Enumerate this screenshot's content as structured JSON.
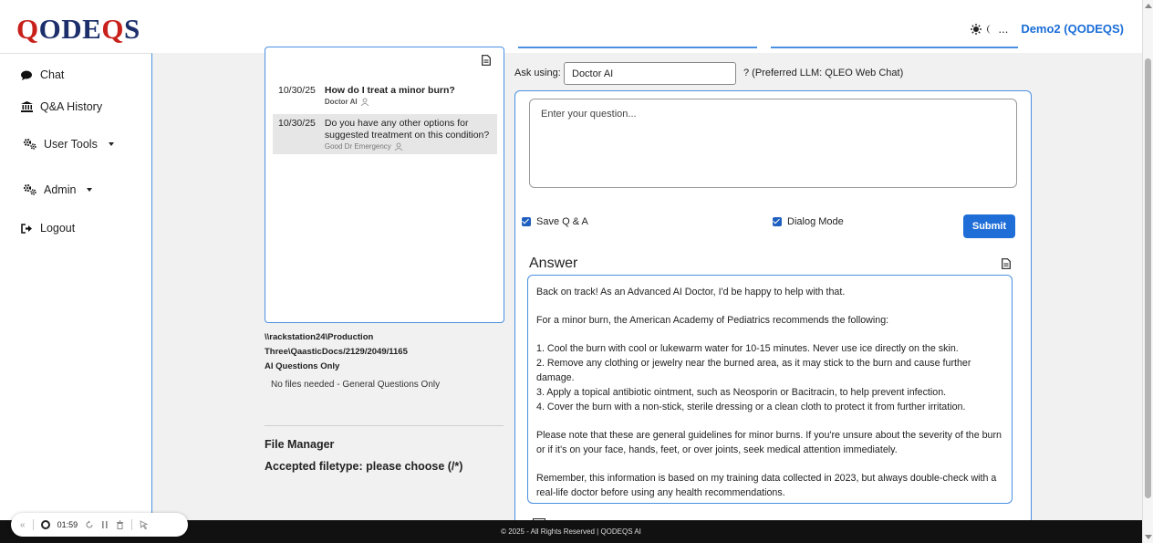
{
  "header": {
    "logo_text": "QODEQS",
    "user_label": "Demo2 (QODEQS)",
    "theme_ellipsis": "..."
  },
  "sidebar": {
    "items": [
      {
        "label": "Chat",
        "icon": "chat-bubble-icon"
      },
      {
        "label": "Q&A History",
        "icon": "bank-icon"
      },
      {
        "label": "User Tools",
        "icon": "gears-icon"
      },
      {
        "label": "Admin",
        "icon": "gears-icon"
      },
      {
        "label": "Logout",
        "icon": "logout-icon"
      }
    ]
  },
  "history": {
    "entries": [
      {
        "date": "10/30/25",
        "question": "How do I treat a minor burn?",
        "source": "Doctor AI"
      },
      {
        "date": "10/30/25",
        "question": "Do you have any other options for suggested treatment on this condition?",
        "source": "Good Dr Emergency"
      }
    ]
  },
  "files": {
    "path": "\\\\rackstation24\\Production Three\\QaasticDocs/2129/2049/1165",
    "mode": "AI Questions Only",
    "no_files": "No files needed - General Questions Only",
    "manager_title": "File Manager",
    "accepted": "Accepted filetype: please choose (/*)"
  },
  "ask": {
    "label": "Ask using:",
    "model": "Doctor AI",
    "preferred": "? (Preferred LLM: QLEO Web Chat)"
  },
  "question": {
    "placeholder": "Enter your question..."
  },
  "options": {
    "save_label": "Save Q & A",
    "dialog_label": "Dialog Mode",
    "submit_label": "Submit"
  },
  "answer": {
    "title": "Answer",
    "p1": "Back on track! As an Advanced AI Doctor, I'd be happy to help with that.",
    "p2": "For a minor burn, the American Academy of Pediatrics recommends the following:",
    "step1": "1. Cool the burn with cool or lukewarm water for 10-15 minutes. Never use ice directly on the skin.",
    "step2": "2. Remove any clothing or jewelry near the burned area, as it may stick to the burn and cause further damage.",
    "step3": "3. Apply a topical antibiotic ointment, such as Neosporin or Bacitracin, to help prevent infection.",
    "step4": "4. Cover the burn with a non-stick, sterile dressing or a clean cloth to protect it from further irritation.",
    "p3": "Please note that these are general guidelines for minor burns. If you're unsure about the severity of the burn or if it's on your face, hands, feet, or over joints, seek medical attention immediately.",
    "p4": "Remember, this information is based on my training data collected in 2023, but always double-check with a real-life doctor before using any health recommendations."
  },
  "footer": {
    "text": "© 2025 - All Rights Reserved | QODEQS AI"
  },
  "recorder": {
    "time": "01:59"
  },
  "colors": {
    "accent": "#4a90e2",
    "submit": "#1f6ed8",
    "logo_red": "#c8201a",
    "logo_navy": "#1d2f6b"
  }
}
